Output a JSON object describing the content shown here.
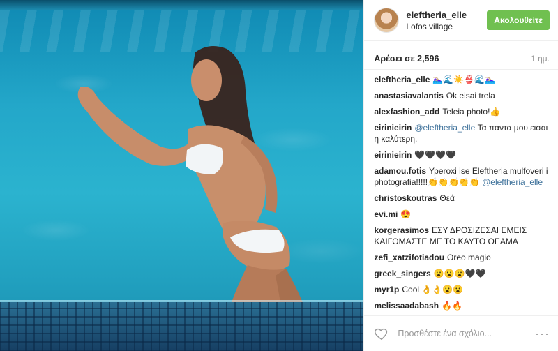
{
  "post": {
    "username": "eleftheria_elle",
    "location": "Lofos village",
    "follow_label": "Ακολουθείτε",
    "likes_label": "Αρέσει σε 2,596",
    "time_label": "1 ημ."
  },
  "comments": [
    {
      "user": "eleftheria_elle",
      "text": "🏊🏼‍♀️🌊☀️👙🌊🏊🏼‍♀️"
    },
    {
      "user": "anastasiavalantis",
      "text": "Ok eisai trela"
    },
    {
      "user": "alexfashion_add",
      "text": "Teleia photo!👍"
    },
    {
      "user": "eirinieirin",
      "mention": "@eleftheria_elle",
      "text": " Τα παντα μου εισαι η καλύτερη."
    },
    {
      "user": "eirinieirin",
      "text": "🖤🖤🖤🖤"
    },
    {
      "user": "adamou.fotis",
      "text": "Yperoxi ise Eleftheria mulfoveri i photografia!!!!!👏👏👏👏👏 ",
      "mention_after": "@eleftheria_elle"
    },
    {
      "user": "christoskoutras",
      "text": "Θεά"
    },
    {
      "user": "evi.mi",
      "text": "😍"
    },
    {
      "user": "korgerasimos",
      "text": "ΕΣΥ ΔΡΟΣΙΖΕΣΑΙ ΕΜΕΙΣ ΚΑΙΓΟΜΑΣΤΕ ΜΕ ΤΟ ΚΑΥΤΟ ΘΕΑΜΑ"
    },
    {
      "user": "zefi_xatzifotiadou",
      "text": "Oreo magio"
    },
    {
      "user": "greek_singers",
      "text": "😮😮😮🖤🖤"
    },
    {
      "user": "myr1p",
      "text": "Cool 👌👌😮😮"
    },
    {
      "user": "melissaadabash",
      "text": "🔥🔥"
    }
  ],
  "footer": {
    "add_comment_placeholder": "Προσθέστε ένα σχόλιο...",
    "more_label": "···"
  },
  "icons": {
    "like": "heart-outline-icon",
    "options": "more-options-icon"
  },
  "colors": {
    "follow_button": "#70c050",
    "mention": "#3f729b",
    "muted": "#999999"
  }
}
